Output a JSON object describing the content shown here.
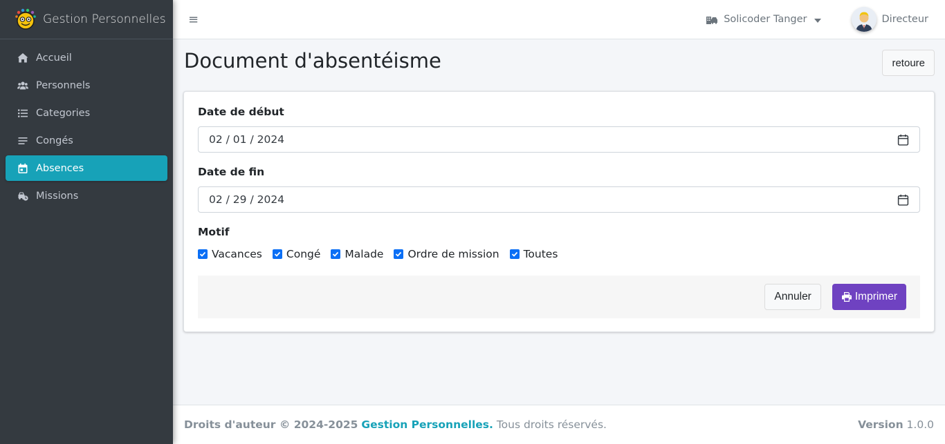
{
  "brand": {
    "name": "Gestion Personnelles"
  },
  "sidebar": {
    "items": [
      {
        "label": "Accueil"
      },
      {
        "label": "Personnels"
      },
      {
        "label": "Categories"
      },
      {
        "label": "Congés"
      },
      {
        "label": "Absences"
      },
      {
        "label": "Missions"
      }
    ]
  },
  "header": {
    "company": "Solicoder Tanger",
    "user_role": "Directeur"
  },
  "page": {
    "title": "Document d'absentéisme",
    "back_label": "retoure"
  },
  "form": {
    "start_label": "Date de début",
    "start_value": "02 / 01 / 2024",
    "end_label": "Date de fin",
    "end_value": "02 / 29 / 2024",
    "motif_label": "Motif",
    "motifs": [
      {
        "label": "Vacances",
        "checked": true
      },
      {
        "label": "Congé",
        "checked": true
      },
      {
        "label": "Malade",
        "checked": true
      },
      {
        "label": "Ordre de mission",
        "checked": true
      },
      {
        "label": "Toutes",
        "checked": true
      }
    ],
    "cancel_label": "Annuler",
    "print_label": "Imprimer"
  },
  "footer": {
    "copyright": "Droits d'auteur © 2024-2025",
    "brand": "Gestion Personnelles.",
    "rights": "Tous droits réservés.",
    "version_label": "Version",
    "version_value": "1.0.0"
  },
  "colors": {
    "sidebar_bg": "#343a40",
    "active_item": "#17a2b8",
    "print_button": "#6f42c1",
    "checkbox": "#0b6ff5"
  }
}
